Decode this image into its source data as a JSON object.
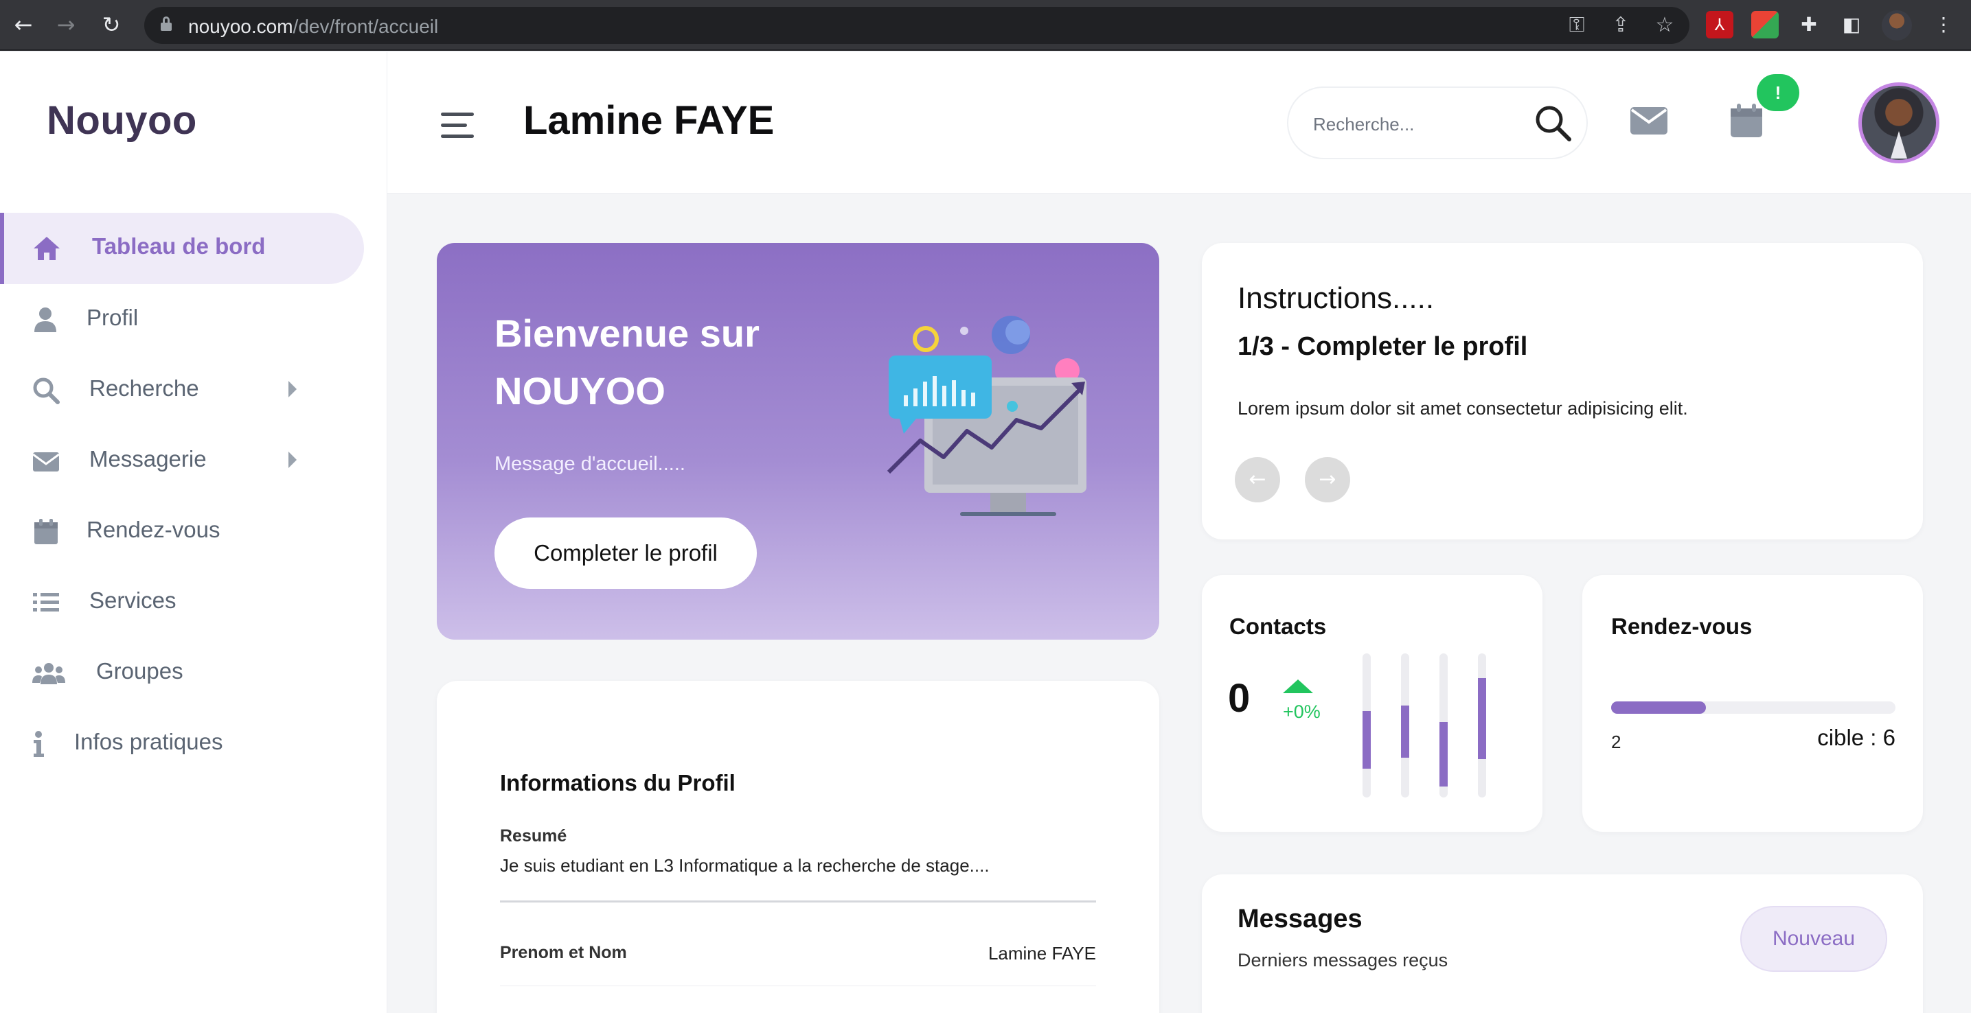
{
  "browser": {
    "url_host": "nouyoo.com",
    "url_path": "/dev/front/accueil"
  },
  "sidebar": {
    "brand": "Nouyoo",
    "items": [
      {
        "label": "Tableau de bord",
        "icon": "home-icon",
        "active": true
      },
      {
        "label": "Profil",
        "icon": "user-icon"
      },
      {
        "label": "Recherche",
        "icon": "search-icon",
        "submenu": true
      },
      {
        "label": "Messagerie",
        "icon": "envelope-icon",
        "submenu": true
      },
      {
        "label": "Rendez-vous",
        "icon": "calendar-icon"
      },
      {
        "label": "Services",
        "icon": "list-icon"
      },
      {
        "label": "Groupes",
        "icon": "users-icon"
      },
      {
        "label": "Infos pratiques",
        "icon": "info-icon"
      }
    ]
  },
  "header": {
    "title": "Lamine FAYE",
    "search_placeholder": "Recherche...",
    "notification_badge": "!"
  },
  "welcome": {
    "title": "Bienvenue sur NOUYOO",
    "message": "Message d'accueil.....",
    "button": "Completer le profil"
  },
  "instructions": {
    "title": "Instructions.....",
    "step": "1/3 - Completer le profil",
    "text": "Lorem ipsum dolor sit amet consectetur adipisicing elit.",
    "prev_icon": "arrow-left-icon",
    "next_icon": "arrow-right-icon"
  },
  "contacts": {
    "title": "Contacts",
    "value": "0",
    "change": "+0%"
  },
  "rendezvous": {
    "title": "Rendez-vous",
    "current": "2",
    "target": "cible : 6",
    "progress_fraction": 0.333
  },
  "profile": {
    "title": "Informations du Profil",
    "resume_label": "Resumé",
    "resume_value": "Je suis etudiant en L3 Informatique a la recherche de stage....",
    "rows": [
      {
        "key": "Prenom et Nom",
        "value": "Lamine FAYE"
      }
    ]
  },
  "messages": {
    "title": "Messages",
    "subtitle": "Derniers messages reçus",
    "button": "Nouveau"
  },
  "colors": {
    "accent": "#8b6cc4",
    "brand_dark": "#3f3454",
    "success": "#22c55e"
  }
}
